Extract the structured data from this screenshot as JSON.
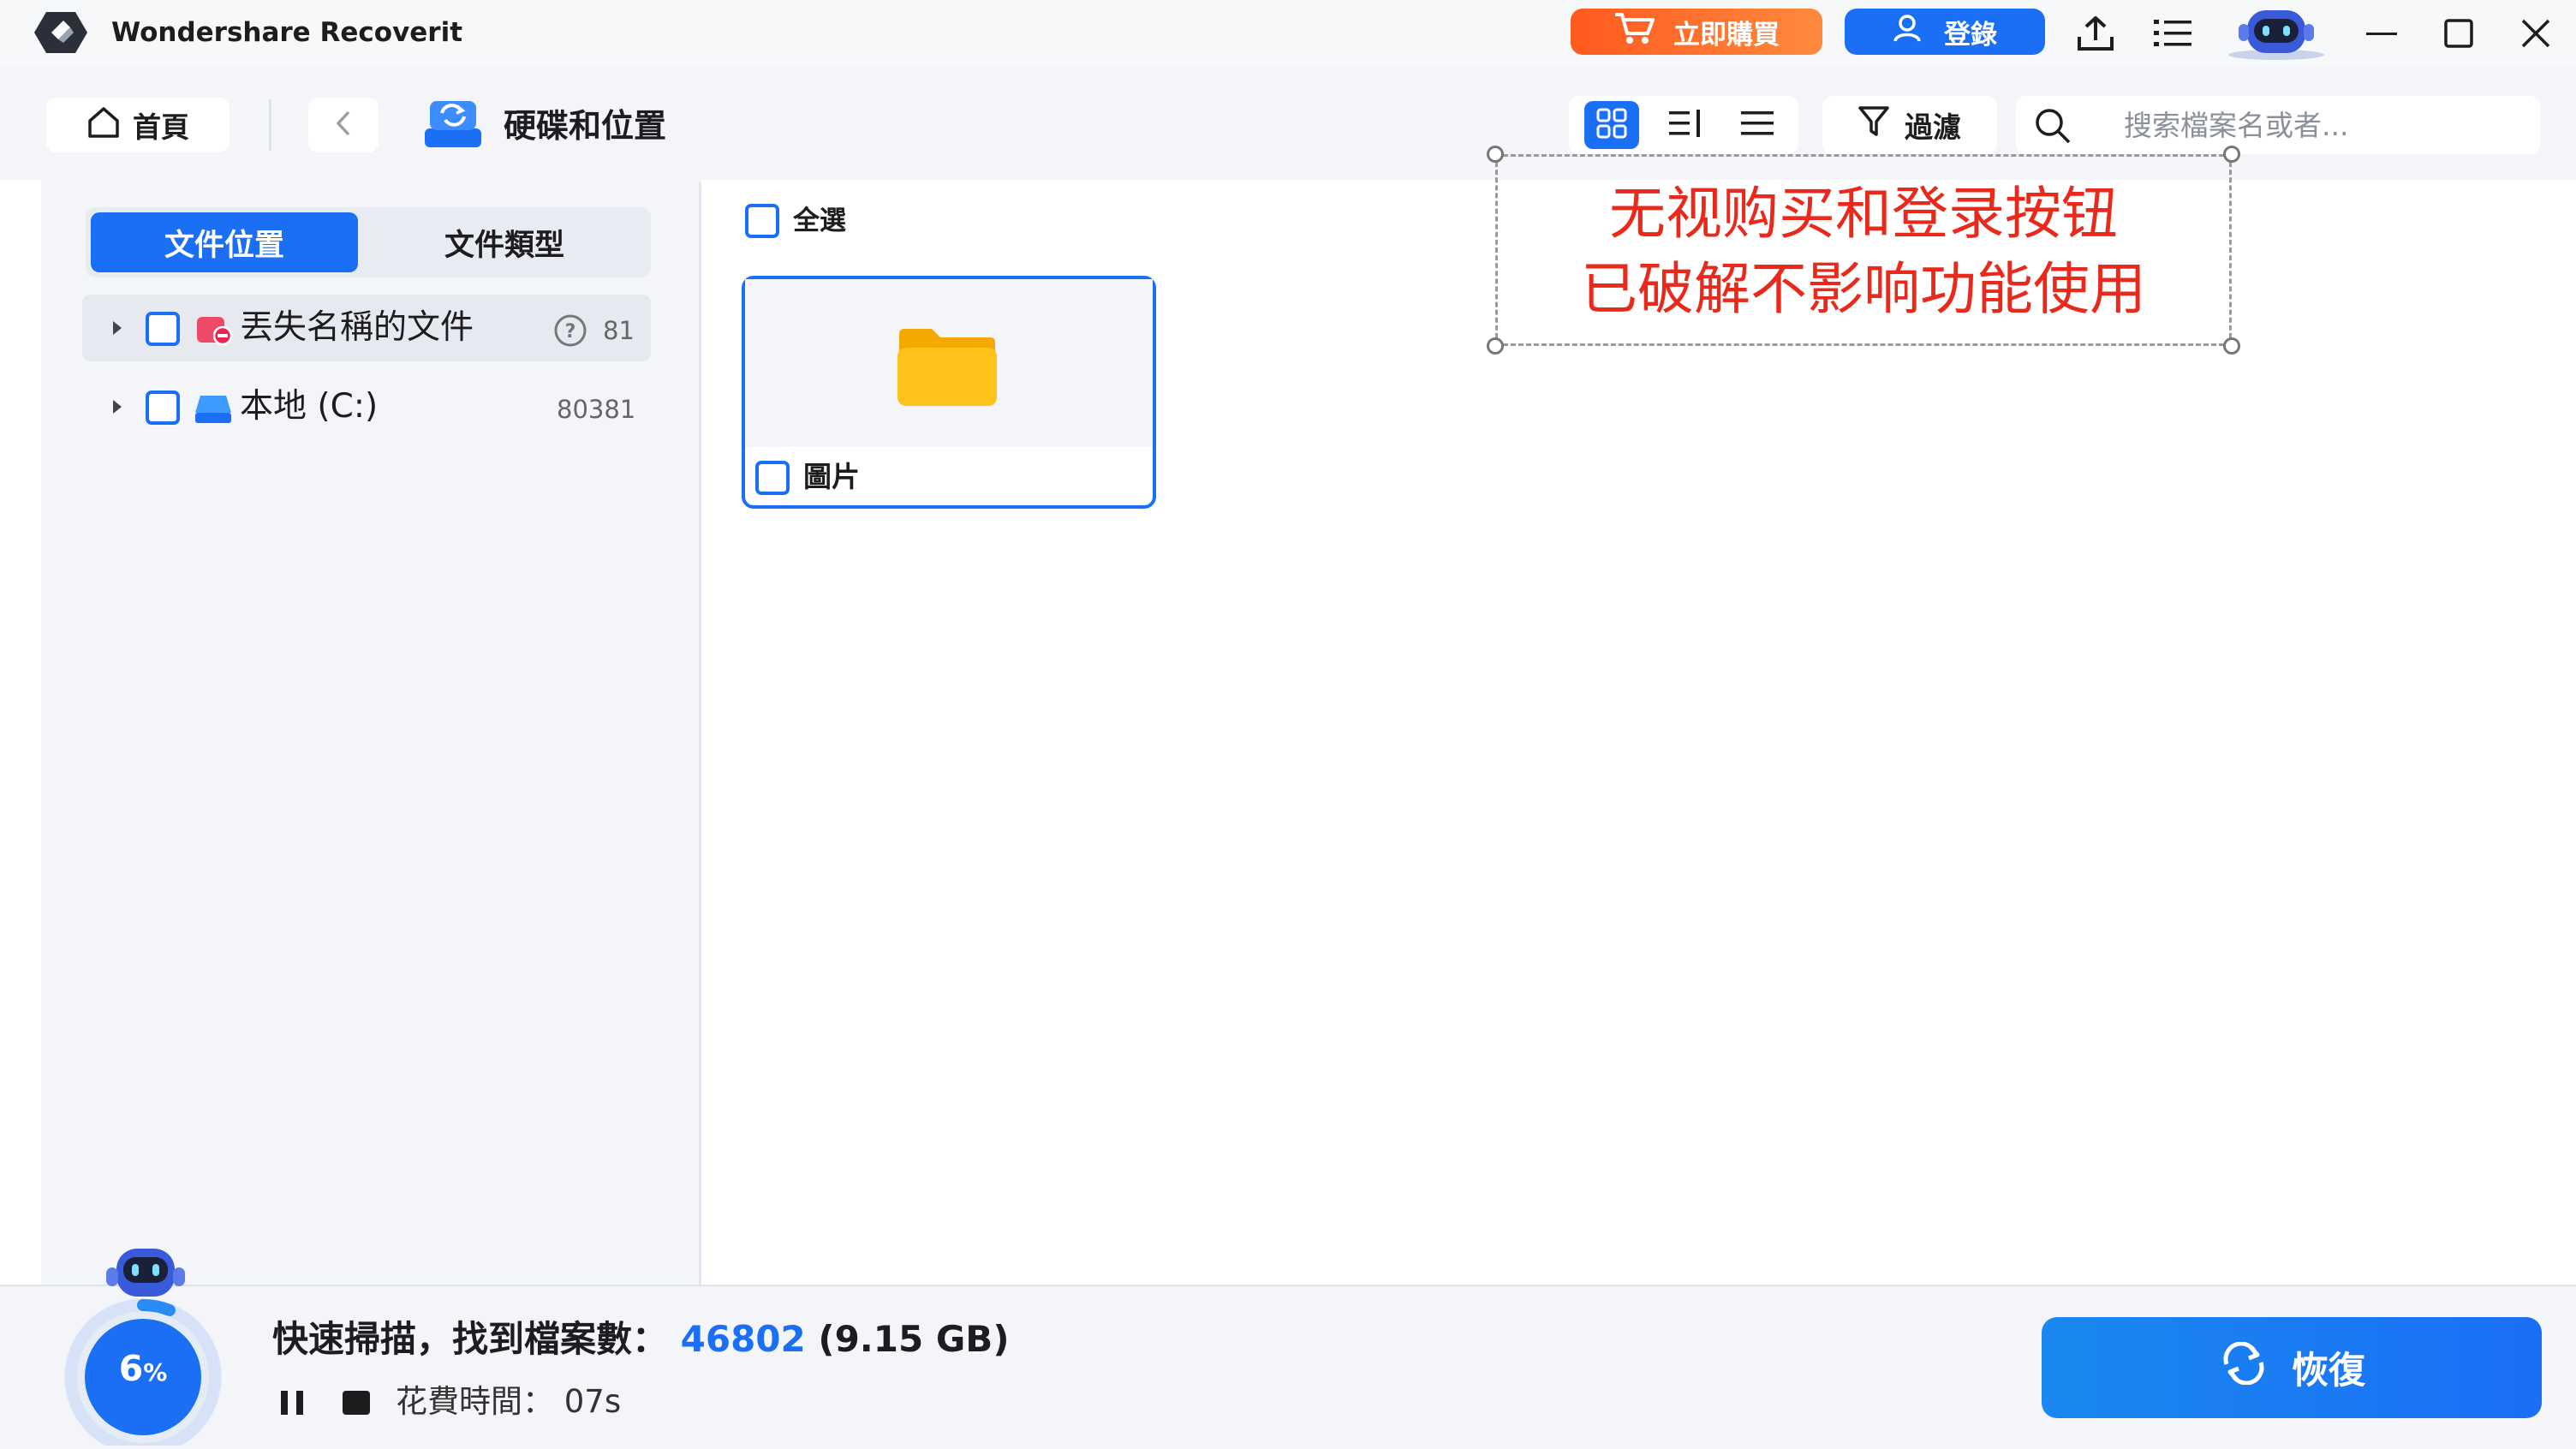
{
  "app": {
    "title": "Wondershare Recoverit"
  },
  "titlebar": {
    "buy_label": "立即購買",
    "login_label": "登錄"
  },
  "toolbar": {
    "home_label": "首頁",
    "page_title": "硬碟和位置",
    "filter_label": "過濾",
    "search_placeholder": "搜索檔案名或者..."
  },
  "sidebar": {
    "tabs": [
      {
        "label": "文件位置",
        "active": true
      },
      {
        "label": "文件類型",
        "active": false
      }
    ],
    "items": [
      {
        "label": "丟失名稱的文件",
        "count": "81",
        "has_help": true
      },
      {
        "label": "本地 (C:)",
        "count": "80381",
        "has_help": false
      }
    ]
  },
  "main": {
    "select_all_label": "全選",
    "folders": [
      {
        "label": "圖片"
      }
    ]
  },
  "annotation": {
    "line1": "无视购买和登录按钮",
    "line2": "已破解不影响功能使用"
  },
  "status": {
    "progress_percent": 6,
    "progress_number": "6",
    "progress_unit": "%",
    "scan_label": "快速掃描，找到檔案數：",
    "file_count": "46802",
    "file_size": "(9.15 GB)",
    "time_label": "花費時間：",
    "time_value": "07s"
  },
  "recover_label": "恢復",
  "colors": {
    "accent": "#1a6ff5",
    "buy_orange": "#ff6a2a",
    "annotation_red": "#e8291c",
    "folder_yellow": "#ffc21a"
  },
  "icons": {
    "logo": "recoverit-logo",
    "cart": "cart-icon",
    "user": "user-icon",
    "upload": "upload-icon",
    "menu": "menu-icon",
    "home": "home-icon",
    "back": "chevron-left-icon",
    "drive": "drive-location-icon",
    "filter": "filter-icon",
    "search": "search-icon",
    "folder": "folder-icon",
    "recover": "recover-icon"
  }
}
